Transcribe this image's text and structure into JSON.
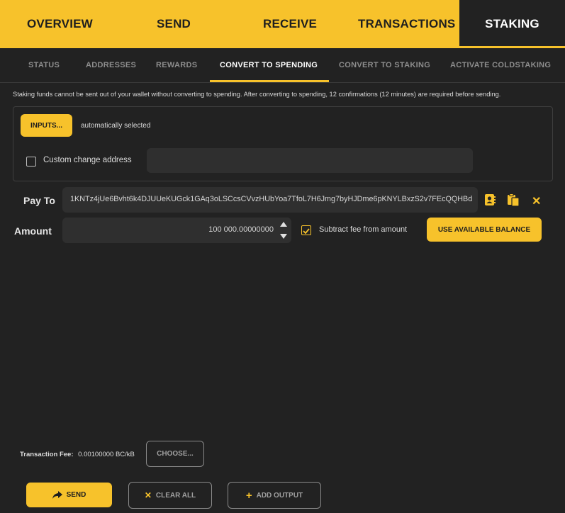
{
  "top_tabs": [
    {
      "label": "OVERVIEW",
      "active": false
    },
    {
      "label": "SEND",
      "active": false
    },
    {
      "label": "RECEIVE",
      "active": false
    },
    {
      "label": "TRANSACTIONS",
      "active": false
    },
    {
      "label": "STAKING",
      "active": true
    }
  ],
  "sub_tabs": [
    {
      "label": "STATUS",
      "active": false
    },
    {
      "label": "ADDRESSES",
      "active": false
    },
    {
      "label": "REWARDS",
      "active": false
    },
    {
      "label": "CONVERT TO SPENDING",
      "active": true
    },
    {
      "label": "CONVERT TO STAKING",
      "active": false
    },
    {
      "label": "ACTIVATE COLDSTAKING",
      "active": false
    }
  ],
  "info_text": "Staking funds cannot be sent out of your wallet without converting to spending. After converting to spending, 12 confirmations (12 minutes) are required before sending.",
  "coin_control": {
    "inputs_label": "INPUTS...",
    "inputs_status": "automatically selected",
    "custom_change_label": "Custom change address",
    "custom_change_checked": false,
    "custom_change_value": ""
  },
  "pay_to": {
    "label": "Pay To",
    "address": "1KNTz4jUe6Bvht6k4DJUUeKUGck1GAq3oLSCcsCVvzHUbYoa7TfoL7H6Jmg7byHJDme6pKNYLBxzS2v7FEcQQHBd",
    "icons": [
      "address-book-icon",
      "paste-icon",
      "delete-icon"
    ]
  },
  "amount": {
    "label": "Amount",
    "value": "100 000.00000000",
    "subtract_fee_label": "Subtract fee from amount",
    "subtract_fee_checked": true,
    "use_balance_label": "USE AVAILABLE BALANCE"
  },
  "fee": {
    "label": "Transaction Fee:",
    "value": "0.00100000 BC/kB",
    "choose_label": "CHOOSE..."
  },
  "actions": {
    "send_label": "SEND",
    "clear_label": "CLEAR ALL",
    "add_output_label": "ADD OUTPUT"
  },
  "colors": {
    "accent": "#f7c22b",
    "background": "#222222",
    "field": "#2f2f2f"
  }
}
